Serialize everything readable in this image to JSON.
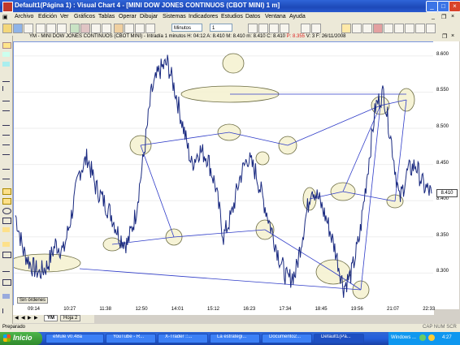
{
  "window": {
    "title": "Default1(Página 1) : Visual Chart 4 - [MINI DOW JONES CONTINUOS (CBOT MINI) 1 m]"
  },
  "menu": [
    "Archivo",
    "Edición",
    "Ver",
    "Gráficos",
    "Tablas",
    "Operar",
    "Dibujar",
    "Sistemas",
    "Indicadores",
    "Estudios",
    "Datos",
    "Ventana",
    "Ayuda"
  ],
  "toolbar": {
    "timeframe": "Minutos",
    "period": "1"
  },
  "chart": {
    "header": "YM - MINI DOW JONES CONTINUOS (CBOT MINI) - Intradía 1 minutos  H: 04:12  A: 8.410  M: 8.410  m: 8.410  C: 8.410",
    "header_p": "P: 8.355",
    "header_tail": "V: 3  F: 26/11/2008",
    "current_price": "8.410",
    "no_orders": "Sin órdenes"
  },
  "tabs": {
    "t1": "YM",
    "t2": "Hoja 2"
  },
  "status": {
    "left": "Preparado",
    "right": "CAP  NUM  SCR"
  },
  "taskbar": {
    "start": "Inicio",
    "items": [
      "eMule v0.48a",
      "YouTube - R...",
      "X-Trader ::...",
      "La estrategi...",
      "Documento2...",
      "Default1(Pá..."
    ],
    "tray_text": "Windows ...",
    "clock": "4:27"
  },
  "colors": {
    "price_line": "#1a2a80",
    "ellipse_fill": "#f4f1cf",
    "trend_line": "#2f3cc8",
    "title_bar": "#2558d6"
  },
  "chart_data": {
    "type": "line",
    "y_ticks": [
      "8.600",
      "8.550",
      "8.500",
      "8.450",
      "8.400",
      "8.350",
      "8.300"
    ],
    "x_ticks": [
      "09:14",
      "10:27",
      "11:38",
      "12:50",
      "14:01",
      "15:12",
      "16:23",
      "17:34",
      "18:45",
      "19:56",
      "21:07",
      "22:33"
    ],
    "ylim": [
      8.26,
      8.61
    ],
    "x": [
      0,
      5,
      10,
      15,
      20,
      25,
      30,
      35,
      40,
      45,
      50,
      55,
      60,
      65,
      70,
      75,
      80,
      85,
      90,
      95,
      100
    ],
    "values": [
      8.38,
      8.33,
      8.31,
      8.3,
      8.31,
      8.34,
      8.33,
      8.38,
      8.44,
      8.46,
      8.42,
      8.4,
      8.38,
      8.35,
      8.34,
      8.38,
      8.46,
      8.55,
      8.58,
      8.59,
      8.55,
      8.5,
      8.45,
      8.47,
      8.46,
      8.42,
      8.35,
      8.38,
      8.43,
      8.46,
      8.44,
      8.4,
      8.36,
      8.32,
      8.29,
      8.3,
      8.36,
      8.42,
      8.4,
      8.37,
      8.33,
      8.28,
      8.3,
      8.35,
      8.44,
      8.53,
      8.55,
      8.48,
      8.4,
      8.44,
      8.45,
      8.42,
      8.41
    ]
  }
}
